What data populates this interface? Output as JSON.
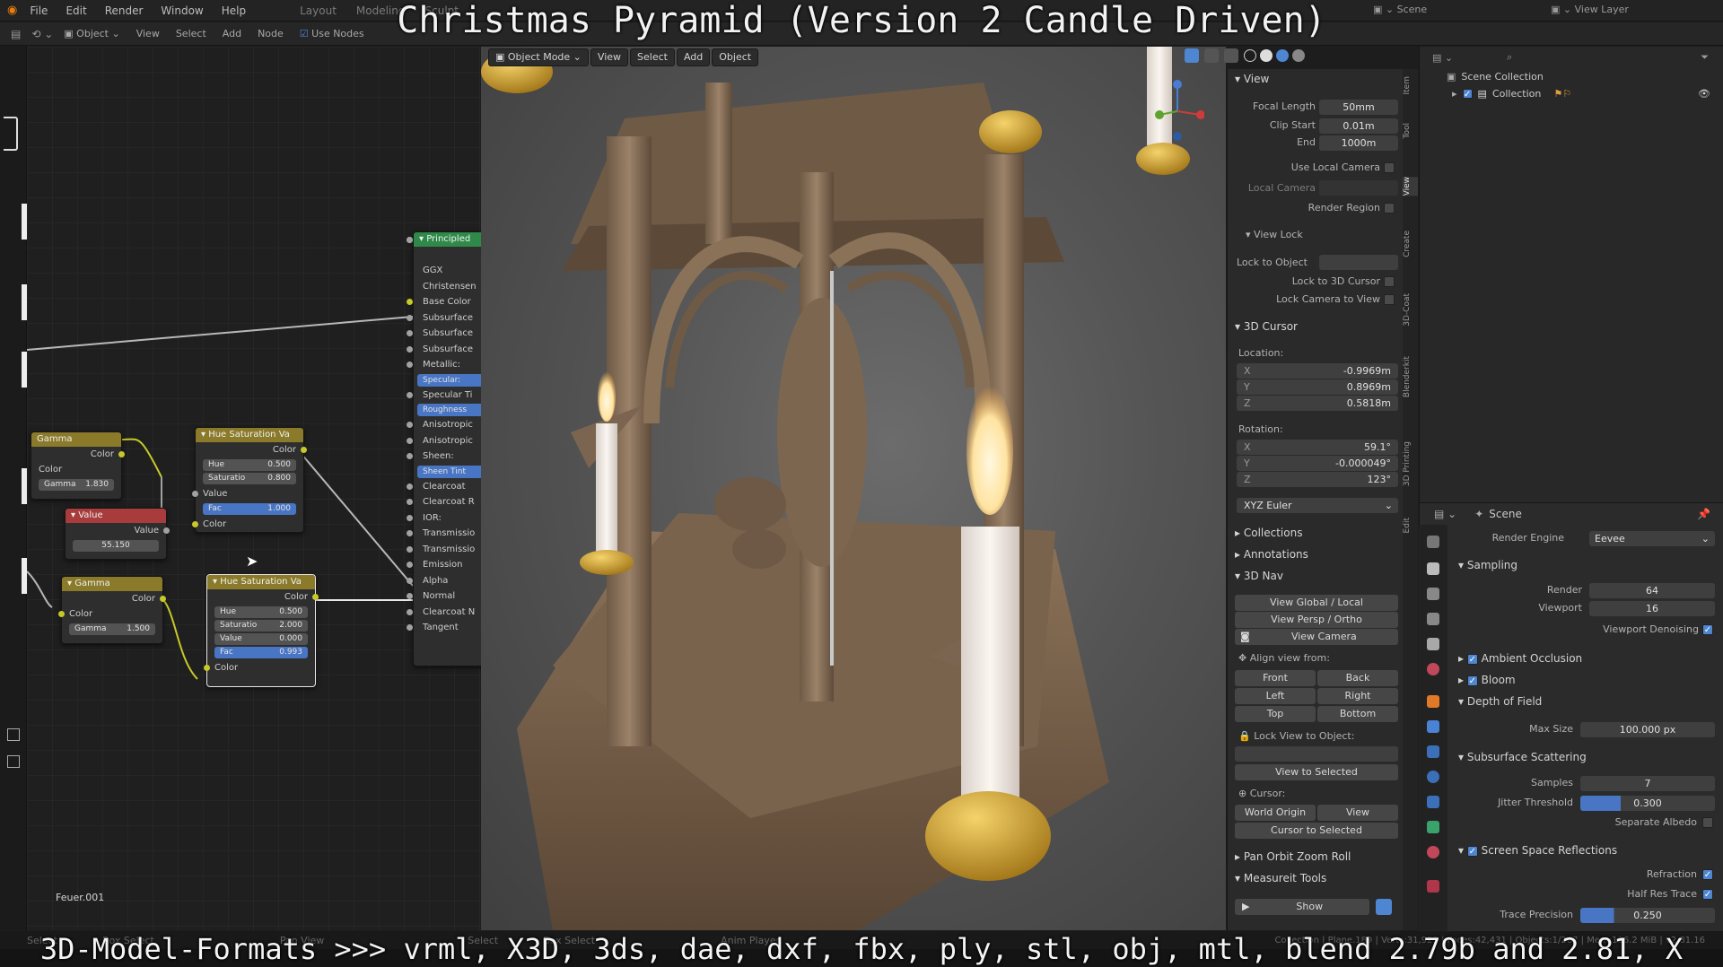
{
  "title_overlay": "Christmas Pyramid (Version 2 Candle Driven)",
  "bottom_overlay": "3D-Model-Formats >>> vrml, X3D, 3ds, dae, dxf, fbx, ply, stl, obj, mtl, blend 2.79b and 2.81, X",
  "menu": [
    "File",
    "Edit",
    "Render",
    "Window",
    "Help"
  ],
  "workspace_tabs": [
    "Layout",
    "Modeling",
    "Sculpt"
  ],
  "top_right": {
    "scene": "Scene",
    "view_layer": "View Layer"
  },
  "node_editor": {
    "header": [
      "Object",
      "View",
      "Select",
      "Add",
      "Node",
      "Use Nodes"
    ],
    "object_label": "Feuer.001",
    "nodes": {
      "principled": {
        "title": "Principled",
        "rows": [
          "GGX",
          "Christensen",
          "Base Color",
          "Subsurface",
          "Subsurface",
          "Subsurface",
          "Metallic:",
          "Specular:",
          "Specular Ti",
          "Roughness",
          "Anisotropic",
          "Anisotropic",
          "Sheen:",
          "Sheen Tint",
          "Clearcoat",
          "Clearcoat R",
          "IOR:",
          "Transmissio",
          "Transmissio",
          "Emission",
          "Alpha",
          "Normal",
          "Clearcoat N",
          "Tangent"
        ]
      },
      "gamma1": {
        "title": "Gamma",
        "out": "Color",
        "in": "Color",
        "gamma_label": "Gamma",
        "gamma_value": "1.830"
      },
      "value": {
        "title": "Value",
        "out": "Value",
        "value": "55.150"
      },
      "gamma2": {
        "title": "Gamma",
        "out": "Color",
        "in": "Color",
        "gamma_label": "Gamma",
        "gamma_value": "1.500"
      },
      "hue1": {
        "title": "Hue Saturation Va",
        "out": "Color",
        "hue_label": "Hue",
        "hue": "0.500",
        "sat_label": "Saturatio",
        "sat": "0.800",
        "val_label": "Value",
        "fac_label": "Fac",
        "fac": "1.000",
        "color_label": "Color"
      },
      "hue2": {
        "title": "Hue Saturation Va",
        "out": "Color",
        "hue_label": "Hue",
        "hue": "0.500",
        "sat_label": "Saturatio",
        "sat": "2.000",
        "val_label": "Value",
        "val": "0.000",
        "fac_label": "Fac",
        "fac": "0.993",
        "color_label": "Color"
      }
    }
  },
  "viewport": {
    "mode": "Object Mode",
    "header": [
      "View",
      "Select",
      "Add",
      "Object"
    ]
  },
  "n_panel": {
    "view_section": "View",
    "focal_length_label": "Focal Length",
    "focal_length": "50mm",
    "clip_start_label": "Clip Start",
    "clip_start": "0.01m",
    "end_label": "End",
    "end": "1000m",
    "use_local_camera": "Use Local Camera",
    "local_camera": "Local Camera",
    "render_region": "Render Region",
    "view_lock": "View Lock",
    "lock_to_object": "Lock to Object",
    "lock_to_cursor": "Lock to 3D Cursor",
    "lock_camera_to_view": "Lock Camera to View",
    "cursor_section": "3D Cursor",
    "location": "Location:",
    "loc": [
      {
        "axis": "X",
        "v": "-0.9969m"
      },
      {
        "axis": "Y",
        "v": "0.8969m"
      },
      {
        "axis": "Z",
        "v": "0.5818m"
      }
    ],
    "rotation": "Rotation:",
    "rot": [
      {
        "axis": "X",
        "v": "59.1°"
      },
      {
        "axis": "Y",
        "v": "-0.000049°"
      },
      {
        "axis": "Z",
        "v": "123°"
      }
    ],
    "euler": "XYZ Euler",
    "collections": "Collections",
    "annotations": "Annotations",
    "nav3d": "3D Nav",
    "view_global_local": "View Global / Local",
    "view_persp_ortho": "View Persp / Ortho",
    "view_camera": "View Camera",
    "align_view_from": "Align view from:",
    "front": "Front",
    "back": "Back",
    "left": "Left",
    "right": "Right",
    "top": "Top",
    "bottom": "Bottom",
    "lock_view_to_object": "Lock View to Object:",
    "view_to_selected": "View to Selected",
    "cursor_label": "Cursor:",
    "world_origin": "World Origin",
    "view": "View",
    "cursor_to_selected": "Cursor to Selected",
    "pan_orbit": "Pan Orbit Zoom Roll",
    "measureit": "Measureit Tools",
    "show": "Show",
    "tabs": [
      "Item",
      "Tool",
      "View",
      "Create",
      "3D-Coat",
      "Blenderkit",
      "3D Printing",
      "Edit"
    ]
  },
  "outliner": {
    "scene_collection": "Scene Collection",
    "collection": "Collection"
  },
  "properties": {
    "scene": "Scene",
    "render_engine_label": "Render Engine",
    "render_engine": "Eevee",
    "sampling": "Sampling",
    "render_label": "Render",
    "render": "64",
    "viewport_label": "Viewport",
    "viewport": "16",
    "viewport_denoising": "Viewport Denoising",
    "ambient_occlusion": "Ambient Occlusion",
    "bloom": "Bloom",
    "dof": "Depth of Field",
    "max_size_label": "Max Size",
    "max_size": "100.000 px",
    "sss": "Subsurface Scattering",
    "samples_label": "Samples",
    "samples": "7",
    "jitter_label": "Jitter Threshold",
    "jitter": "0.300",
    "separate_albedo": "Separate Albedo",
    "ssr": "Screen Space Reflections",
    "refraction": "Refraction",
    "half_res": "Half Res Trace",
    "trace_label": "Trace Precision",
    "trace": "0.250"
  },
  "status": [
    "Select",
    "Box Select",
    "Pan View",
    "Select",
    "Box Select",
    "Anim Player"
  ],
  "status_right": "Collection | Plane.189 | Verts:31,922 | Faces:42,431 | Objects:1/267 | Mem:116.2 MiB | v2.81.16"
}
